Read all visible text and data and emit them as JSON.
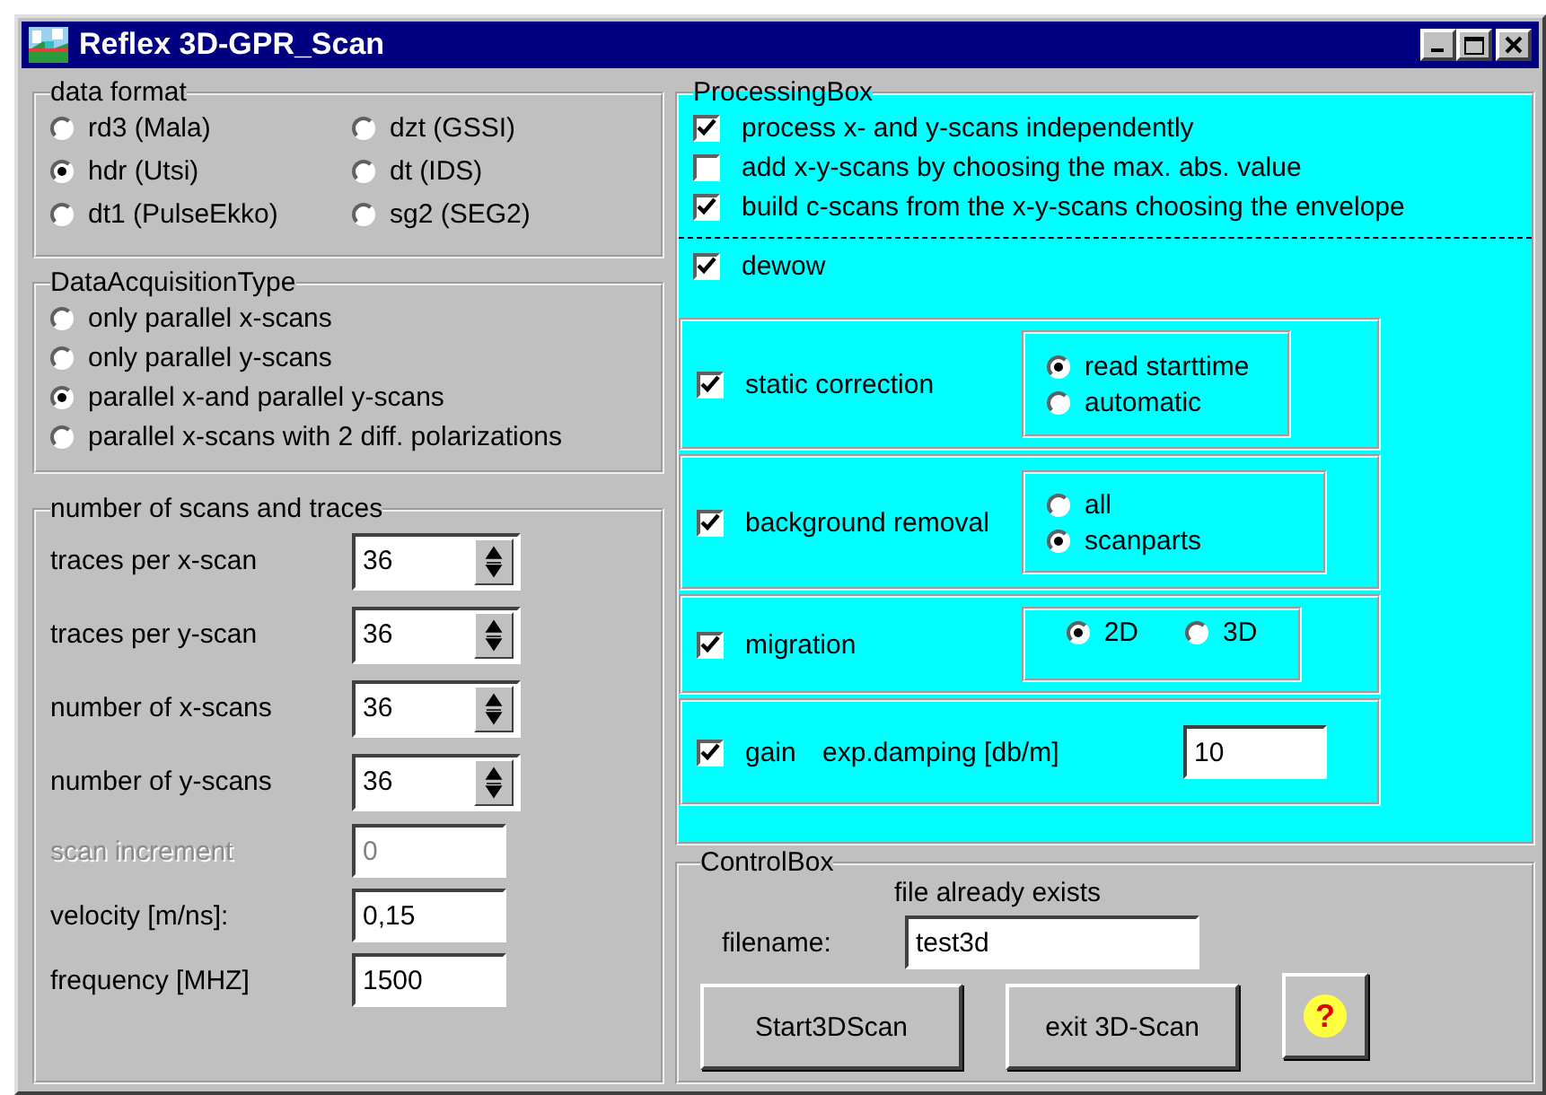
{
  "window": {
    "title": "Reflex 3D-GPR_Scan"
  },
  "data_format": {
    "legend": "data format",
    "options": [
      {
        "label": "rd3 (Mala)",
        "selected": false
      },
      {
        "label": "dzt (GSSI)",
        "selected": false
      },
      {
        "label": "hdr (Utsi)",
        "selected": true
      },
      {
        "label": "dt (IDS)",
        "selected": false
      },
      {
        "label": "dt1 (PulseEkko)",
        "selected": false
      },
      {
        "label": "sg2 (SEG2)",
        "selected": false
      }
    ]
  },
  "acquisition": {
    "legend": "DataAcquisitionType",
    "options": [
      {
        "label": "only parallel x-scans",
        "selected": false
      },
      {
        "label": "only parallel y-scans",
        "selected": false
      },
      {
        "label": "parallel x-and parallel y-scans",
        "selected": true
      },
      {
        "label": "parallel x-scans with 2 diff. polarizations",
        "selected": false
      }
    ]
  },
  "scans": {
    "legend": "number of scans and traces",
    "fields": [
      {
        "kind": "spin",
        "label": "traces per x-scan",
        "value": "36"
      },
      {
        "kind": "spin",
        "label": "traces per y-scan",
        "value": "36"
      },
      {
        "kind": "spin",
        "label": "number of x-scans",
        "value": "36"
      },
      {
        "kind": "spin",
        "label": "number of y-scans",
        "value": "36"
      },
      {
        "kind": "text",
        "label": "scan increment",
        "value": "0",
        "disabled": true
      },
      {
        "kind": "text",
        "label": "velocity [m/ns]:",
        "value": "0,15",
        "disabled": false
      },
      {
        "kind": "text",
        "label": "frequency [MHZ]",
        "value": "1500",
        "disabled": false
      }
    ]
  },
  "processing": {
    "legend": "ProcessingBox",
    "options": [
      {
        "label": "process x- and y-scans independently",
        "checked": true
      },
      {
        "label": "add x-y-scans by choosing the max. abs. value",
        "checked": false
      },
      {
        "label": "build c-scans from the x-y-scans choosing the envelope",
        "checked": true
      }
    ],
    "dewow": {
      "label": "dewow",
      "checked": true
    },
    "sections": [
      {
        "kind": "stacked",
        "label": "static correction",
        "checked": true,
        "options": [
          {
            "label": "read starttime",
            "selected": true
          },
          {
            "label": "automatic",
            "selected": false
          }
        ]
      },
      {
        "kind": "stacked",
        "label": "background removal",
        "checked": true,
        "options": [
          {
            "label": "all",
            "selected": false
          },
          {
            "label": "scanparts",
            "selected": true
          }
        ]
      },
      {
        "kind": "inline",
        "label": "migration",
        "checked": true,
        "options": [
          {
            "label": "2D",
            "selected": true
          },
          {
            "label": "3D",
            "selected": false
          }
        ]
      },
      {
        "kind": "field",
        "label": "gain",
        "checked": true,
        "field_label": "exp.damping [db/m]",
        "value": "10"
      }
    ]
  },
  "control": {
    "legend": "ControlBox",
    "message": "file already exists",
    "filename_label": "filename:",
    "filename": "test3d",
    "buttons": [
      "Start3DScan",
      "exit 3D-Scan"
    ],
    "help": "?"
  }
}
